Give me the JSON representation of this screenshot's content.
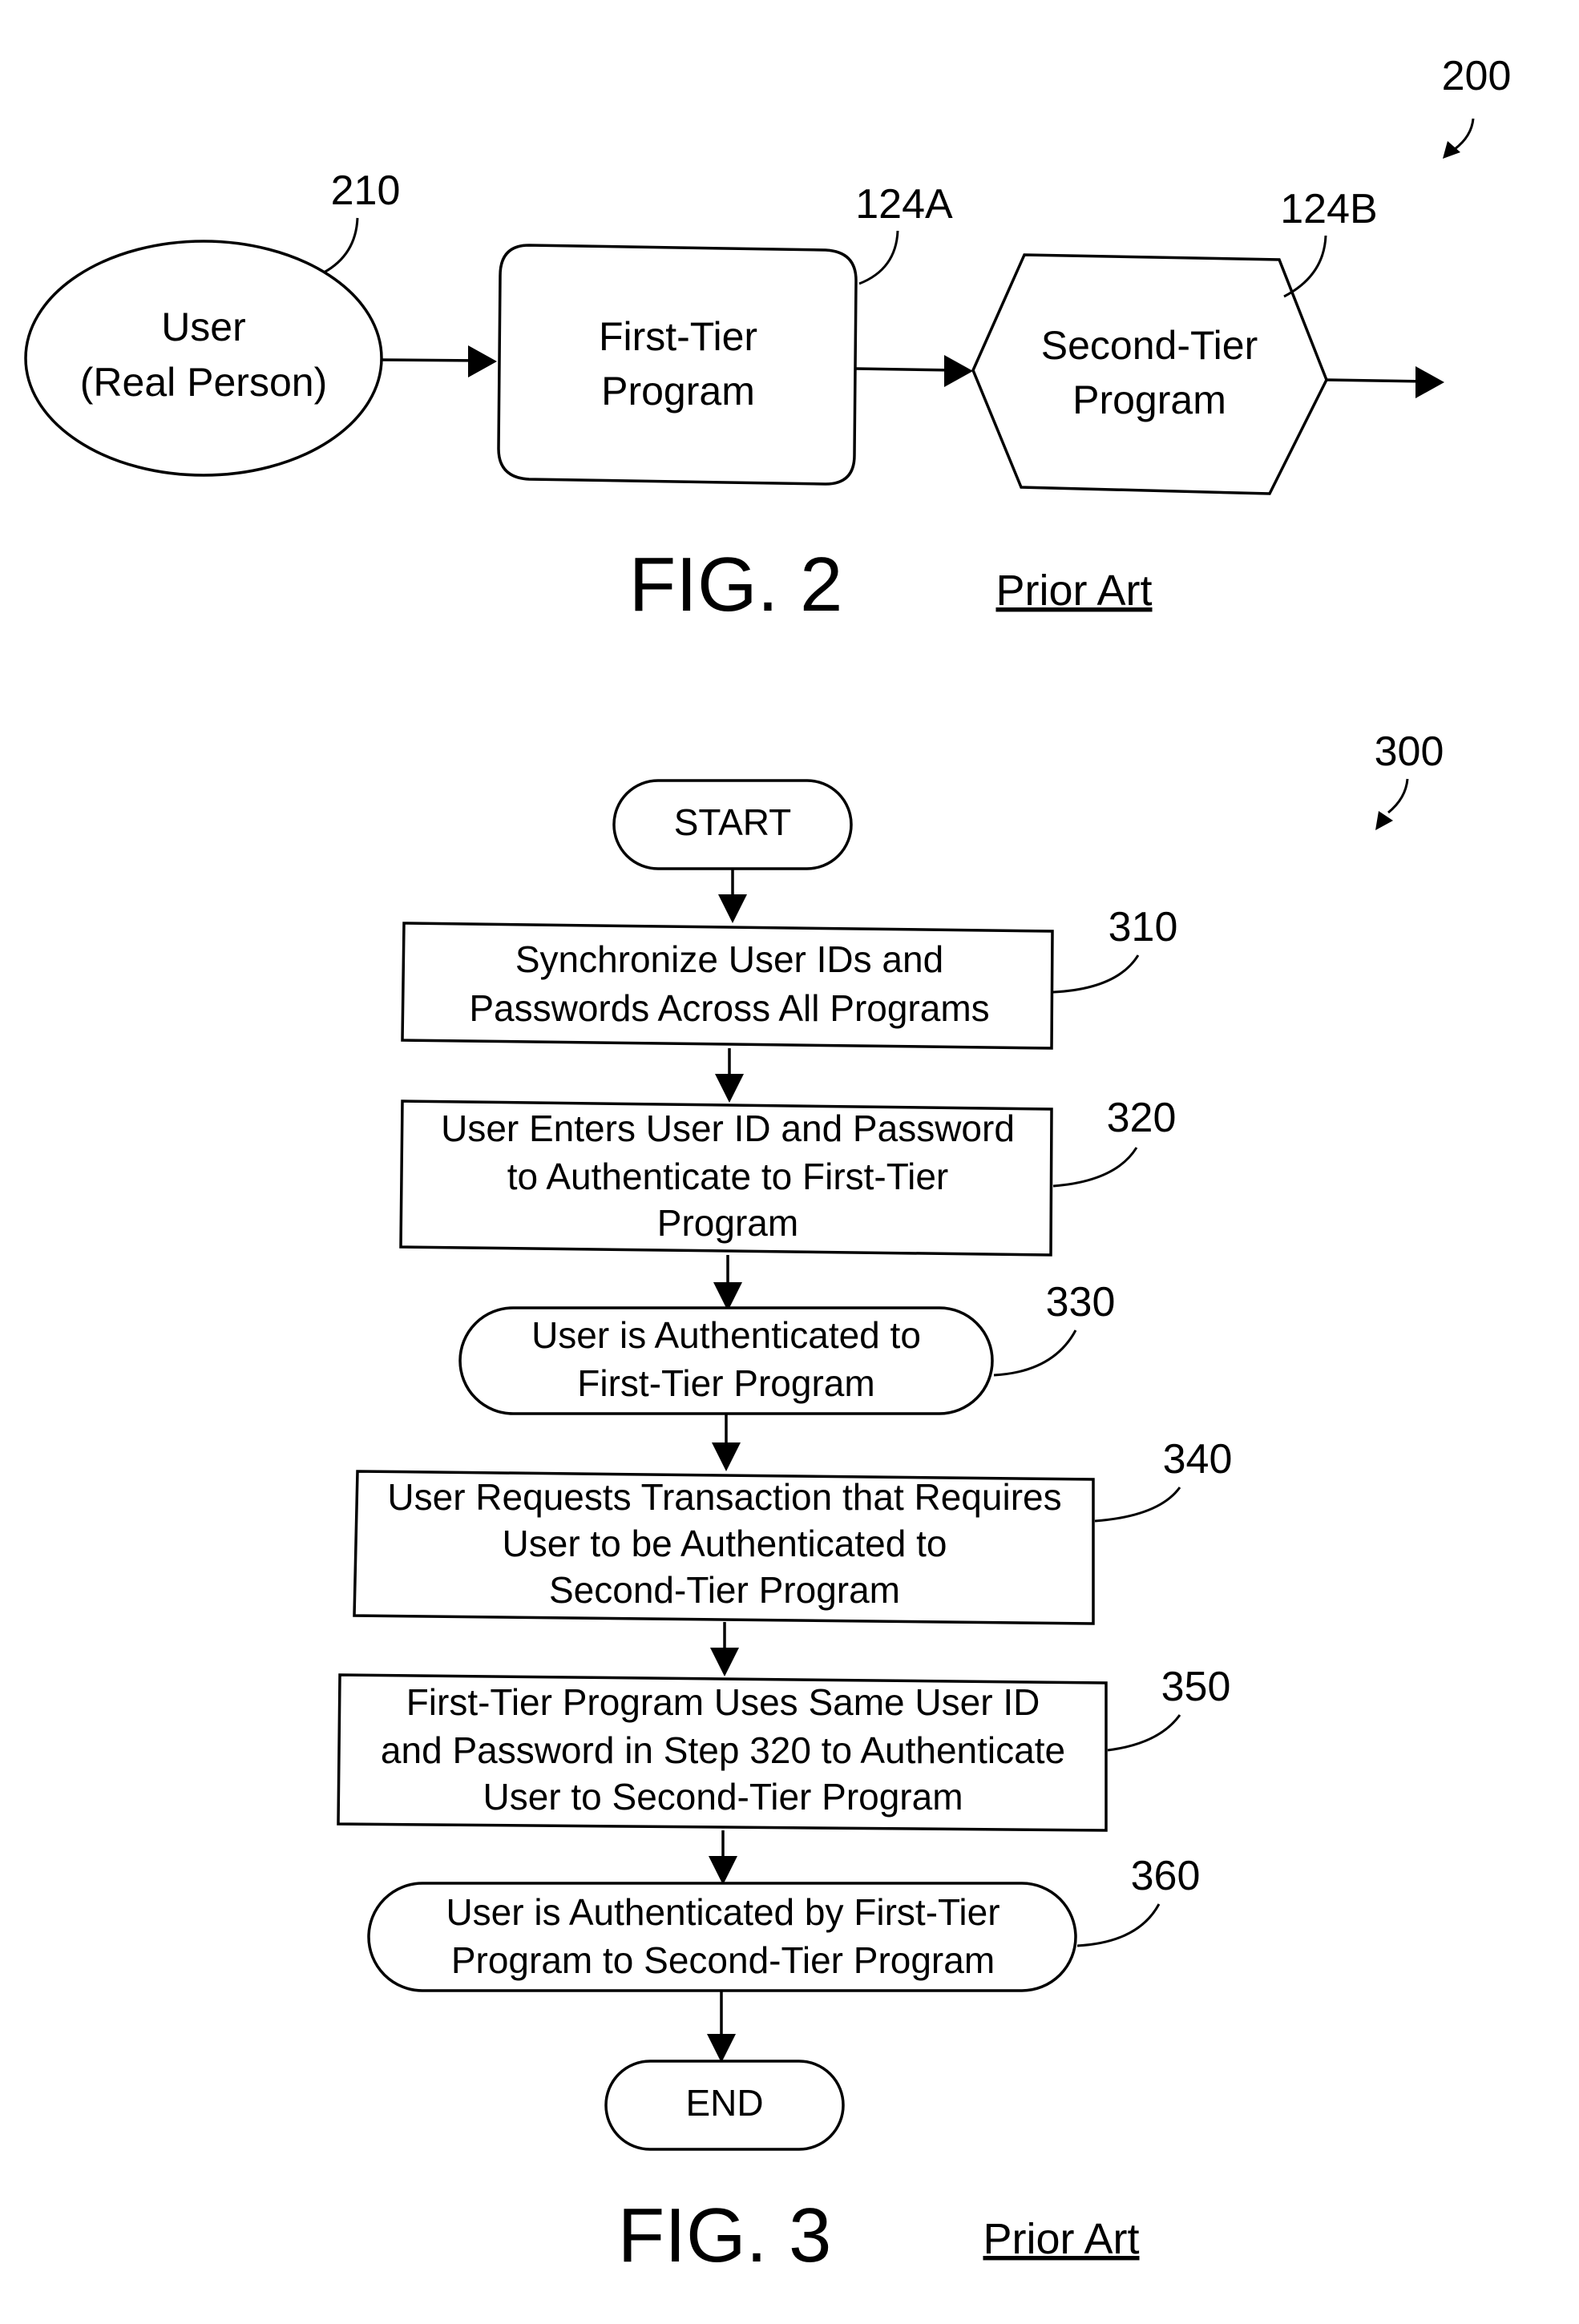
{
  "figure2": {
    "ref_number": "200",
    "caption": "FIG. 2",
    "note": "Prior Art",
    "nodes": [
      {
        "ref": "210",
        "shape": "ellipse",
        "lines": [
          "User",
          "(Real Person)"
        ]
      },
      {
        "ref": "124A",
        "shape": "rounded-rectangle",
        "lines": [
          "First-Tier",
          "Program"
        ]
      },
      {
        "ref": "124B",
        "shape": "hexagon",
        "lines": [
          "Second-Tier",
          "Program"
        ]
      }
    ]
  },
  "figure3": {
    "ref_number": "300",
    "caption": "FIG. 3",
    "note": "Prior Art",
    "start": {
      "label": "START"
    },
    "end": {
      "label": "END"
    },
    "steps": [
      {
        "ref": "310",
        "shape": "rectangle",
        "lines": [
          "Synchronize User IDs and",
          "Passwords Across All Programs"
        ]
      },
      {
        "ref": "320",
        "shape": "rectangle",
        "lines": [
          "User Enters User ID and Password",
          "to Authenticate to First-Tier",
          "Program"
        ]
      },
      {
        "ref": "330",
        "shape": "rounded",
        "lines": [
          "User is Authenticated to",
          "First-Tier Program"
        ]
      },
      {
        "ref": "340",
        "shape": "rectangle",
        "lines": [
          "User Requests Transaction that Requires",
          "User to be Authenticated to",
          "Second-Tier Program"
        ]
      },
      {
        "ref": "350",
        "shape": "rectangle",
        "lines": [
          "First-Tier Program Uses Same User ID",
          "and Password in Step 320 to Authenticate",
          "User to Second-Tier Program"
        ]
      },
      {
        "ref": "360",
        "shape": "rounded",
        "lines": [
          "User is Authenticated by First-Tier",
          "Program to Second-Tier Program"
        ]
      }
    ]
  }
}
